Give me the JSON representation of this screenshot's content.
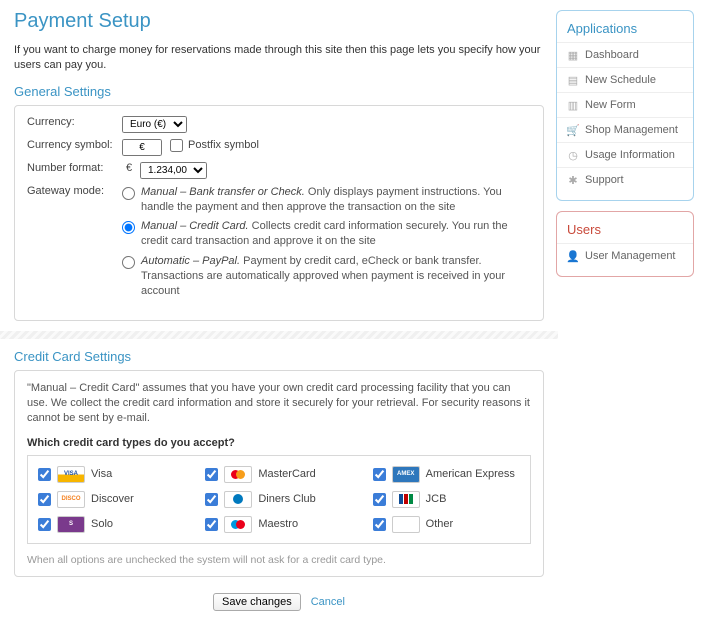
{
  "page": {
    "title": "Payment Setup",
    "intro": "If you want to charge money for reservations made through this site then this page lets you specify how your users can pay you."
  },
  "general": {
    "heading": "General Settings",
    "currency_label": "Currency:",
    "currency_value": "Euro (€)",
    "symbol_label": "Currency symbol:",
    "symbol_value": "€",
    "postfix_label": "Postfix symbol",
    "numfmt_label": "Number format:",
    "numfmt_prefix": "€",
    "numfmt_value": "1.234,00",
    "gateway_label": "Gateway mode:",
    "modes": [
      {
        "title": "Manual – Bank transfer or Check.",
        "desc": " Only displays payment instructions. You handle the payment and then approve the transaction on the site",
        "checked": false
      },
      {
        "title": "Manual – Credit Card.",
        "desc": " Collects credit card information securely. You run the credit card transaction and approve it on the site",
        "checked": true
      },
      {
        "title": "Automatic – PayPal.",
        "desc": " Payment by credit card, eCheck or bank transfer. Transactions are automatically approved when payment is received in your account",
        "checked": false
      }
    ]
  },
  "cc": {
    "heading": "Credit Card Settings",
    "desc": "\"Manual – Credit Card\" assumes that you have your own credit card processing facility that you can use. We collect the credit card information and store it securely for your retrieval. For security reasons it cannot be sent by e-mail.",
    "question": "Which credit card types do you accept?",
    "cards": [
      {
        "label": "Visa",
        "bg": "linear-gradient(#fff 50%,#f7b500 50%)",
        "fg": "#1a4ea2",
        "txt": "VISA"
      },
      {
        "label": "MasterCard",
        "bg": "#fff",
        "fg": "#fff",
        "txt": "",
        "mc": true
      },
      {
        "label": "American Express",
        "bg": "#2e77bc",
        "fg": "#fff",
        "txt": "AMEX"
      },
      {
        "label": "Discover",
        "bg": "#fff",
        "fg": "#f58220",
        "txt": "DISCO"
      },
      {
        "label": "Diners Club",
        "bg": "#fff",
        "fg": "#fff",
        "txt": "",
        "dc": true
      },
      {
        "label": "JCB",
        "bg": "#fff",
        "fg": "#fff",
        "txt": "",
        "jcb": true
      },
      {
        "label": "Solo",
        "bg": "#7a3a8c",
        "fg": "#fff",
        "txt": "S"
      },
      {
        "label": "Maestro",
        "bg": "#fff",
        "fg": "#fff",
        "txt": "",
        "mae": true
      },
      {
        "label": "Other",
        "bg": "#fff",
        "fg": "#888",
        "txt": ""
      }
    ],
    "hint": "When all options are unchecked the system will not ask for a credit card type."
  },
  "actions": {
    "save": "Save changes",
    "cancel": "Cancel"
  },
  "sidebar": {
    "apps": {
      "title": "Applications",
      "items": [
        {
          "label": "Dashboard",
          "glyph": "▦"
        },
        {
          "label": "New Schedule",
          "glyph": "▤"
        },
        {
          "label": "New Form",
          "glyph": "▥"
        },
        {
          "label": "Shop Management",
          "glyph": "🛒"
        },
        {
          "label": "Usage Information",
          "glyph": "◷"
        },
        {
          "label": "Support",
          "glyph": "✱"
        }
      ]
    },
    "users": {
      "title": "Users",
      "items": [
        {
          "label": "User Management",
          "glyph": "👤"
        }
      ]
    }
  }
}
